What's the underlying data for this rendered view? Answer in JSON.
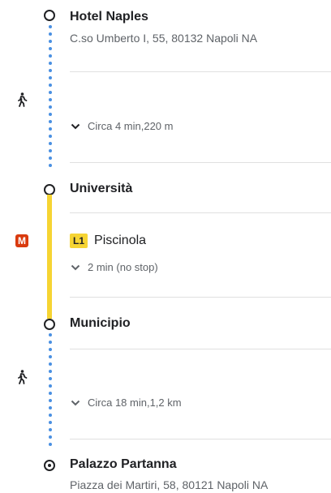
{
  "origin": {
    "name": "Hotel Naples",
    "address": "C.so Umberto I, 55, 80132 Napoli NA"
  },
  "walk1": {
    "icon": "walking-icon",
    "summary": "Circa 4 min,220 m"
  },
  "stop_universita": {
    "name": "Università"
  },
  "transit": {
    "icon": "metro-icon",
    "icon_letter": "M",
    "line_badge": "L1",
    "direction": "Piscinola",
    "summary": "2 min (no stop)",
    "line_color": "#f6d433",
    "metro_color": "#d93a0e"
  },
  "stop_municipio": {
    "name": "Municipio"
  },
  "walk2": {
    "icon": "walking-icon",
    "summary": "Circa 18 min,1,2 km"
  },
  "destination": {
    "name": "Palazzo Partanna",
    "address": "Piazza dei Martiri, 58, 80121 Napoli NA"
  },
  "colors": {
    "walk_dots": "#4a90e2",
    "divider": "#e0e0e0"
  }
}
